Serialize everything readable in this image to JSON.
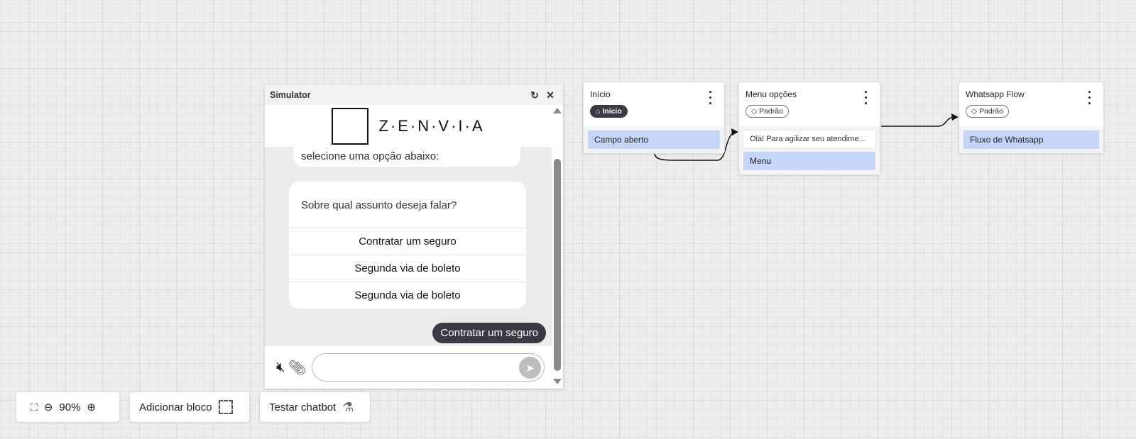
{
  "simulator": {
    "title": "Simulator",
    "logo_text": "Z·E·N·V·I·A",
    "bot_text": "selecione uma opção abaixo:",
    "question": "Sobre qual assunto deseja falar?",
    "options": [
      "Contratar um seguro",
      "Segunda via de boleto",
      "Segunda via de boleto"
    ],
    "user_message": "Contratar um seguro",
    "input_value": "",
    "input_placeholder": ""
  },
  "cards": [
    {
      "title": "Início",
      "tag": "Início",
      "tag_icon": "home-icon",
      "items": [
        "Campo aberto"
      ]
    },
    {
      "title": "Menu opções",
      "tag": "Padrão",
      "tag_icon": "tag-icon",
      "preview": "Olá! Para agilizar seu atendime...",
      "items": [
        "Menu"
      ]
    },
    {
      "title": "Whatsapp Flow",
      "tag": "Padrão",
      "tag_icon": "tag-icon",
      "items": [
        "Fluxo de Whatsapp"
      ]
    }
  ],
  "toolbar": {
    "zoom": "90%",
    "add_block": "Adicionar bloco",
    "test_chatbot": "Testar chatbot"
  },
  "colors": {
    "item": "#c5d5f7",
    "dark": "#3a3a45"
  }
}
